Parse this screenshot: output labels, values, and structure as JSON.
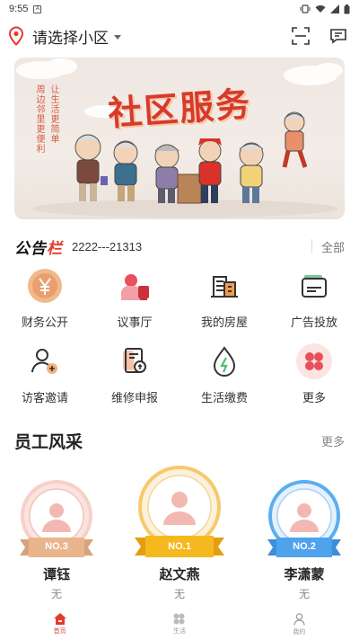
{
  "status_bar": {
    "time": "9:55"
  },
  "header": {
    "community_placeholder": "请选择小区"
  },
  "banner": {
    "title": "社区服务",
    "slogan_right": "让生活更简单",
    "slogan_left": "周边邻里更便利"
  },
  "notice": {
    "logo_text": "公告",
    "logo_accent": "栏",
    "text": "2222---21313",
    "all_label": "全部"
  },
  "services": [
    {
      "label": "财务公开",
      "icon": "yuan-coin-icon"
    },
    {
      "label": "议事厅",
      "icon": "meeting-hall-icon"
    },
    {
      "label": "我的房屋",
      "icon": "building-icon"
    },
    {
      "label": "广告投放",
      "icon": "ad-card-icon"
    },
    {
      "label": "访客邀请",
      "icon": "add-visitor-icon"
    },
    {
      "label": "维修申报",
      "icon": "repair-report-icon"
    },
    {
      "label": "生活缴费",
      "icon": "utility-drop-icon"
    },
    {
      "label": "更多",
      "icon": "more-clover-icon"
    }
  ],
  "staff": {
    "title": "员工风采",
    "more_label": "更多",
    "members": [
      {
        "rank": "NO.3",
        "name": "谭钰",
        "sub": "无",
        "ribbon_color": "#d8a27b"
      },
      {
        "rank": "NO.1",
        "name": "赵文燕",
        "sub": "无",
        "ribbon_color": "#f2b21b"
      },
      {
        "rank": "NO.2",
        "name": "李潇蒙",
        "sub": "无",
        "ribbon_color": "#4a9de8"
      }
    ]
  },
  "bottom_nav": [
    {
      "label": "首页",
      "active": true
    },
    {
      "label": "生活",
      "active": false
    },
    {
      "label": "我的",
      "active": false
    }
  ],
  "colors": {
    "accent": "#e53a2b",
    "text": "#222222"
  }
}
